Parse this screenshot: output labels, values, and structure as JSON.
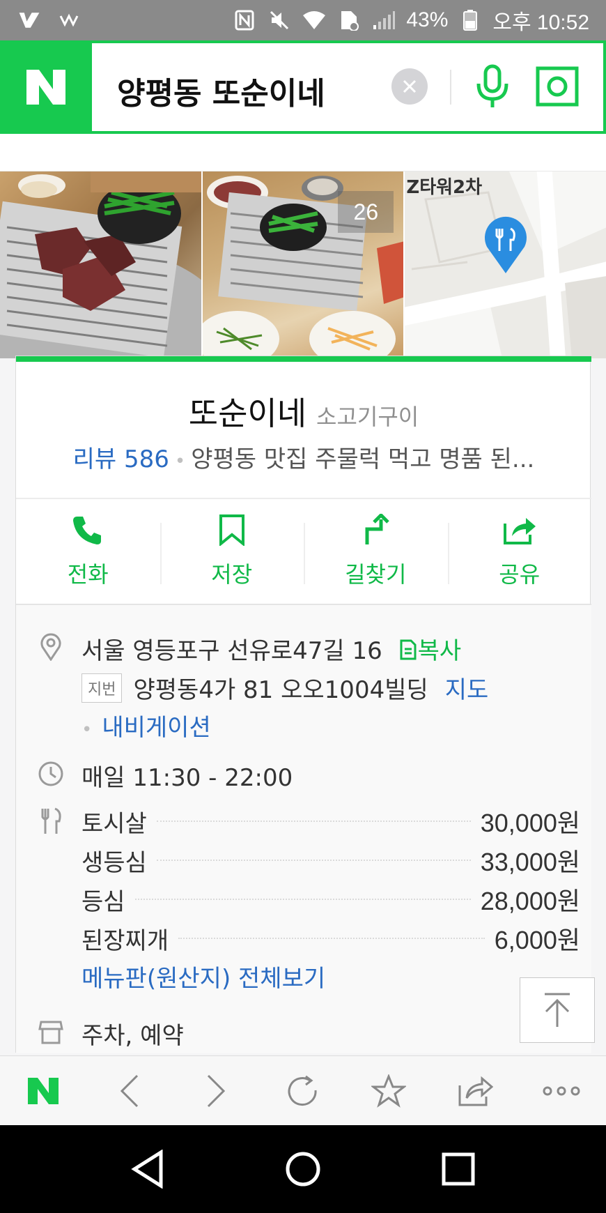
{
  "status_bar": {
    "battery": "43%",
    "time": "오후 10:52"
  },
  "search": {
    "query": "양평동 또순이네"
  },
  "photos": {
    "count": "26",
    "map_label": "Z타워2차"
  },
  "place": {
    "name": "또순이네",
    "category": "소고기구이",
    "review_link": "리뷰 586",
    "review_snippet": "양평동 맛집 주물럭 먹고 명품 된..."
  },
  "actions": {
    "call": "전화",
    "save": "저장",
    "directions": "길찾기",
    "share": "공유"
  },
  "details": {
    "address": "서울 영등포구 선유로47길 16",
    "copy": "복사",
    "jibun_badge": "지번",
    "jibun_address": "양평동4가 81 오오1004빌딩",
    "map_link": "지도",
    "navigation": "내비게이션",
    "hours": "매일 11:30 - 22:00",
    "menu": [
      {
        "name": "토시살",
        "price": "30,000원"
      },
      {
        "name": "생등심",
        "price": "33,000원"
      },
      {
        "name": "등심",
        "price": "28,000원"
      },
      {
        "name": "된장찌개",
        "price": "6,000원"
      }
    ],
    "menu_all": "메뉴판(원산지) 전체보기",
    "parking": "주차, 예약"
  },
  "colors": {
    "brand_green": "#17c94f",
    "link_blue": "#2a6bc2"
  }
}
